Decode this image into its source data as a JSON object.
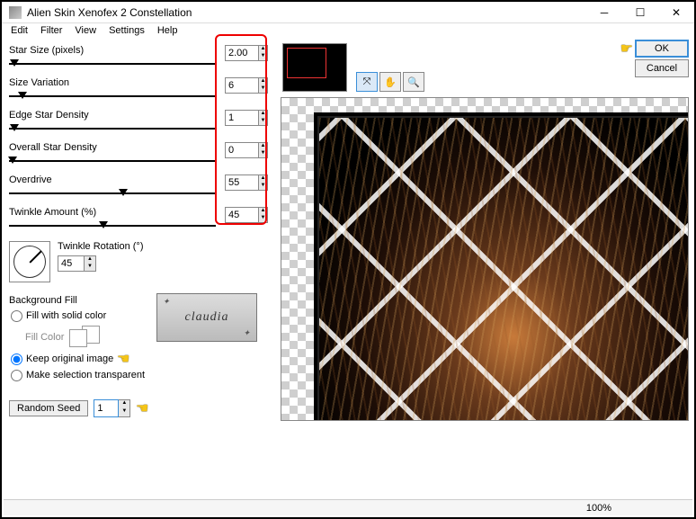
{
  "window": {
    "title": "Alien Skin Xenofex 2 Constellation"
  },
  "menu": {
    "edit": "Edit",
    "filter": "Filter",
    "view": "View",
    "settings": "Settings",
    "help": "Help"
  },
  "sliders": {
    "starSize": {
      "label": "Star Size (pixels)",
      "value": "2.00",
      "thumb_pct": 2
    },
    "sizeVar": {
      "label": "Size Variation",
      "value": "6",
      "thumb_pct": 6
    },
    "edgeDens": {
      "label": "Edge Star Density",
      "value": "1",
      "thumb_pct": 1
    },
    "overall": {
      "label": "Overall Star Density",
      "value": "0",
      "thumb_pct": 0
    },
    "overdrive": {
      "label": "Overdrive",
      "value": "55",
      "thumb_pct": 55
    },
    "twinkleAmt": {
      "label": "Twinkle Amount (%)",
      "value": "45",
      "thumb_pct": 45
    }
  },
  "twinkleRotation": {
    "label": "Twinkle Rotation (°)",
    "value": "45"
  },
  "bgfill": {
    "title": "Background Fill",
    "solid": "Fill with solid color",
    "fillColor": "Fill Color",
    "keep": "Keep original image",
    "transparent": "Make selection transparent",
    "selected": "keep"
  },
  "randomSeed": {
    "button": "Random Seed",
    "value": "1"
  },
  "buttons": {
    "ok": "OK",
    "cancel": "Cancel"
  },
  "claudia": "claudia",
  "status": {
    "zoom": "100%"
  },
  "chart_data": {
    "type": "table",
    "title": "Xenofex 2 Constellation parameters",
    "series": [
      {
        "name": "Star Size (pixels)",
        "value": 2.0
      },
      {
        "name": "Size Variation",
        "value": 6
      },
      {
        "name": "Edge Star Density",
        "value": 1
      },
      {
        "name": "Overall Star Density",
        "value": 0
      },
      {
        "name": "Overdrive",
        "value": 55
      },
      {
        "name": "Twinkle Amount (%)",
        "value": 45
      },
      {
        "name": "Twinkle Rotation (°)",
        "value": 45
      },
      {
        "name": "Random Seed",
        "value": 1
      }
    ]
  }
}
